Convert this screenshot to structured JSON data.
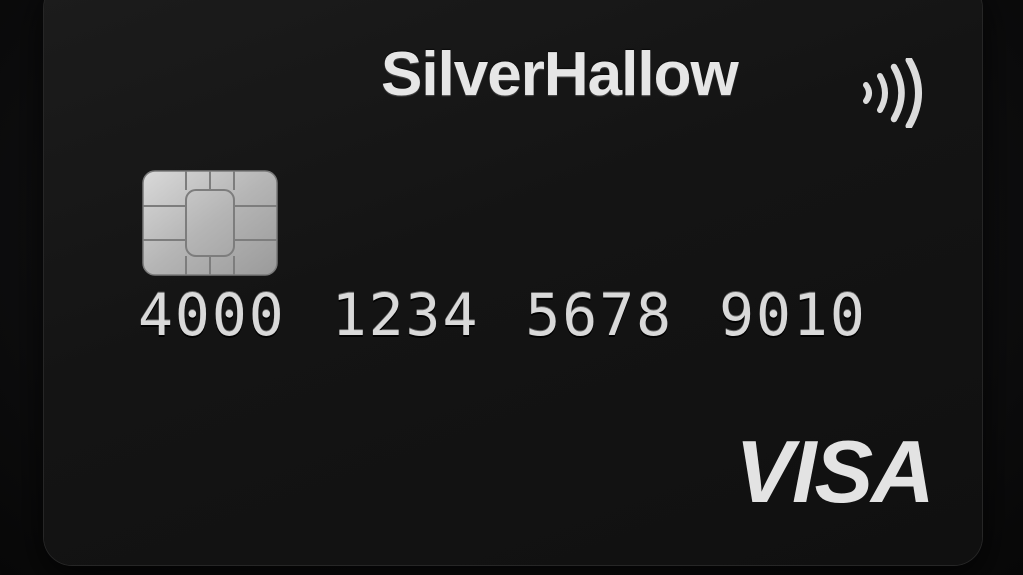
{
  "card": {
    "brand": "SilverHallow",
    "number_groups": [
      "4000",
      "1234",
      "5678",
      "9010"
    ],
    "network": "VISA",
    "contactless_icon": "contactless-icon",
    "chip_icon": "emv-chip-icon"
  },
  "colors": {
    "card_body": "#141414",
    "metallic_text": "#e6e6e6",
    "chip": "#bdbdbd"
  }
}
